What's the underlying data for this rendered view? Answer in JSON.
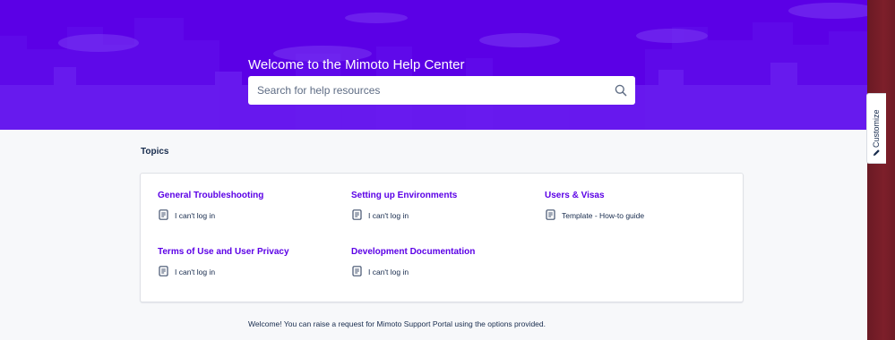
{
  "hero": {
    "title": "Welcome to the Mimoto Help Center",
    "search_placeholder": "Search for help resources",
    "background_color": "#5b00e6"
  },
  "customize_tab": {
    "label": "Customize",
    "icon": "pencil-icon"
  },
  "topics": {
    "heading": "Topics",
    "groups": [
      {
        "title": "General Troubleshooting",
        "articles": [
          "I can't log in"
        ]
      },
      {
        "title": "Setting up Environments",
        "articles": [
          "I can't log in"
        ]
      },
      {
        "title": "Users & Visas",
        "articles": [
          "Template - How-to guide"
        ]
      },
      {
        "title": "Terms of Use and User Privacy",
        "articles": [
          "I can't log in"
        ]
      },
      {
        "title": "Development Documentation",
        "articles": [
          "I can't log in"
        ]
      }
    ]
  },
  "footer": {
    "welcome_text": "Welcome! You can raise a request for Mimoto Support Portal using the options provided."
  },
  "colors": {
    "accent": "#5b00e6",
    "text": "#172b4d",
    "page_background": "#f7f8fa"
  }
}
